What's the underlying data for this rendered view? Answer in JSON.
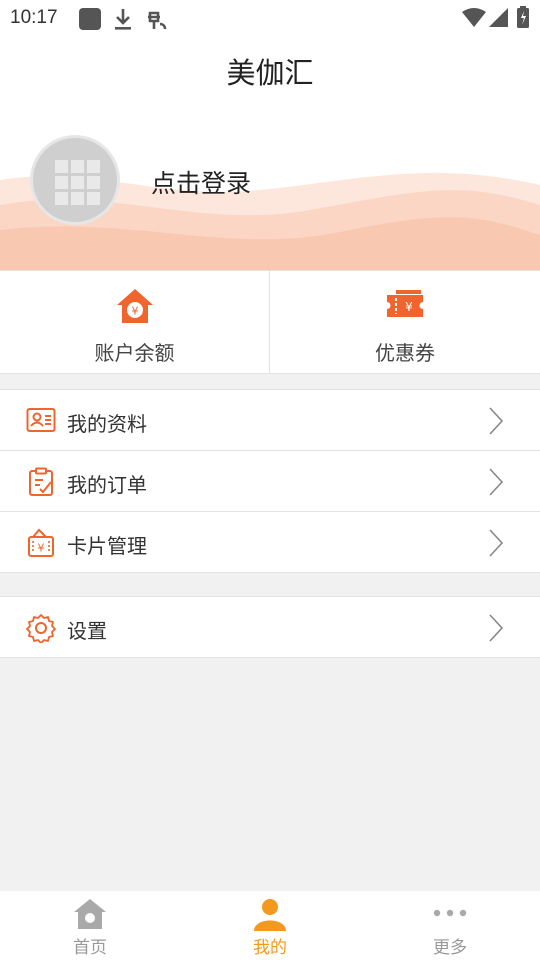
{
  "status_bar": {
    "time": "10:17"
  },
  "header": {
    "title": "美伽汇"
  },
  "profile": {
    "login_text": "点击登录"
  },
  "wallet": {
    "balance_label": "账户余额",
    "coupon_label": "优惠券"
  },
  "menu": {
    "items": [
      {
        "label": "我的资料",
        "icon": "profile-card-icon"
      },
      {
        "label": "我的订单",
        "icon": "clipboard-order-icon"
      },
      {
        "label": "卡片管理",
        "icon": "card-wallet-icon"
      }
    ],
    "settings_label": "设置"
  },
  "tabs": [
    {
      "label": "首页",
      "icon": "home-icon"
    },
    {
      "label": "我的",
      "icon": "person-icon",
      "active": true
    },
    {
      "label": "更多",
      "icon": "more-dots-icon"
    }
  ],
  "colors": {
    "accent": "#f0642d",
    "tab_active": "#f39a1e",
    "wave": "#fbd6c4"
  }
}
